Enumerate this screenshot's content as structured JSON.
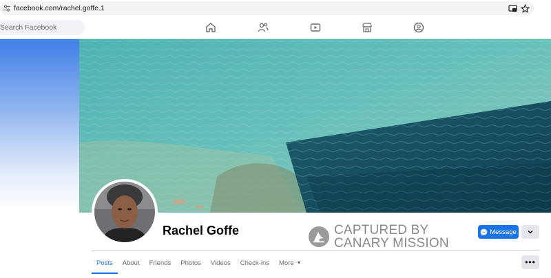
{
  "browser": {
    "url": "facebook.com/rachel.goffe.1"
  },
  "header": {
    "search_placeholder": "Search Facebook"
  },
  "profile": {
    "name": "Rachel Goffe",
    "message_label": "Message"
  },
  "watermark": {
    "line1": "CAPTURED BY",
    "line2": "CANARY MISSION"
  },
  "tabs": [
    {
      "label": "Posts",
      "active": true
    },
    {
      "label": "About"
    },
    {
      "label": "Friends"
    },
    {
      "label": "Photos"
    },
    {
      "label": "Videos"
    },
    {
      "label": "Check-ins"
    },
    {
      "label": "More"
    }
  ],
  "colors": {
    "accent": "#1b74e4"
  },
  "icons": [
    "tune-icon",
    "cast-icon",
    "star-icon",
    "home-icon",
    "friends-icon",
    "watch-icon",
    "marketplace-icon",
    "groups-icon",
    "messenger-icon",
    "chevron-down-icon",
    "more-dots-icon"
  ]
}
